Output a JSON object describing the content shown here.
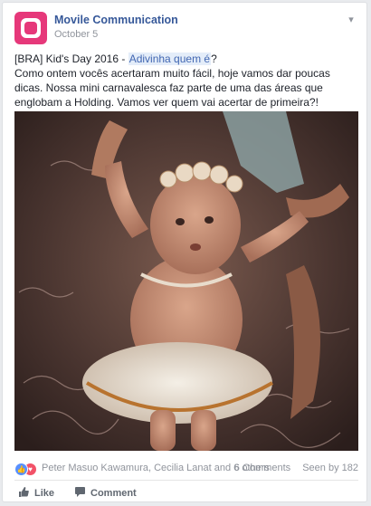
{
  "post": {
    "page_name": "Movile Communication",
    "date": "October 5",
    "text": {
      "line1_prefix": "[BRA] Kid's Day 2016 - ",
      "line1_highlight": "Adivinha quem é",
      "line1_suffix": "?",
      "body": "Como ontem vocês acertaram muito fácil, hoje vamos dar poucas dicas. Nossa mini carnavalesca faz parte de uma das áreas que englobam a Holding. Vamos ver quem vai acertar de primeira?!"
    },
    "photo": {
      "description_icon": "vintage-baby-photo"
    }
  },
  "reactions": {
    "icons": [
      "like-icon",
      "love-icon"
    ],
    "names": "Peter Masuo Kawamura, Cecilia Lanat and 6 others",
    "comments": "6 Comments",
    "seen": "Seen by 182"
  },
  "actions": {
    "like_label": "Like",
    "comment_label": "Comment"
  },
  "colors": {
    "brand": "#e6387a",
    "link": "#365899",
    "meta": "#90949c"
  }
}
